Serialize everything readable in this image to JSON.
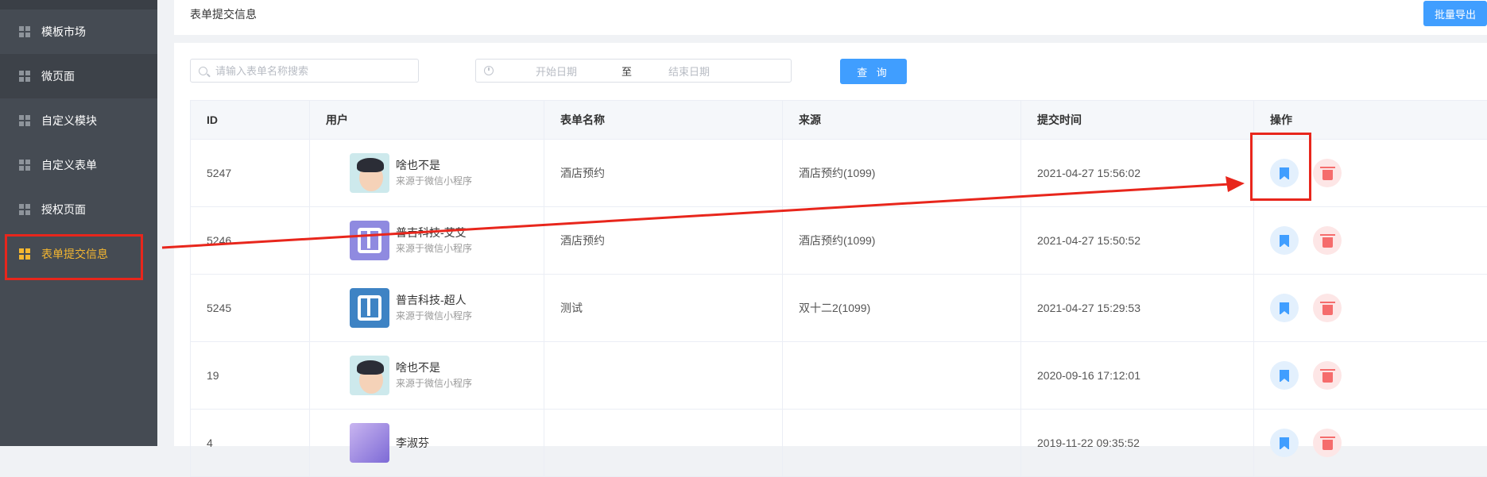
{
  "sidebar": {
    "items": [
      {
        "label": "模板市场",
        "icon": "grid-icon"
      },
      {
        "label": "微页面",
        "icon": "grid-icon"
      },
      {
        "label": "自定义模块",
        "icon": "grid-icon"
      },
      {
        "label": "自定义表单",
        "icon": "grid-icon"
      },
      {
        "label": "授权页面",
        "icon": "grid-icon"
      },
      {
        "label": "表单提交信息",
        "icon": "grid-icon"
      }
    ],
    "active_color": "#f5b730"
  },
  "header": {
    "title": "表单提交信息",
    "export_label": "批量导出"
  },
  "filters": {
    "search_placeholder": "请输入表单名称搜索",
    "date_start_placeholder": "开始日期",
    "date_separator": "至",
    "date_end_placeholder": "结束日期",
    "query_label": "查 询"
  },
  "table": {
    "columns": [
      "ID",
      "用户",
      "表单名称",
      "来源",
      "提交时间",
      "操作"
    ],
    "rows": [
      {
        "id": "5247",
        "user": "啥也不是",
        "user_source": "来源于微信小程序",
        "form": "酒店预约",
        "source": "酒店预约(1099)",
        "time": "2021-04-27 15:56:02"
      },
      {
        "id": "5246",
        "user": "普吉科技-艾艾",
        "user_source": "来源于微信小程序",
        "form": "酒店预约",
        "source": "酒店预约(1099)",
        "time": "2021-04-27 15:50:52"
      },
      {
        "id": "5245",
        "user": "普吉科技-超人",
        "user_source": "来源于微信小程序",
        "form": "测试",
        "source": "双十二2(1099)",
        "time": "2021-04-27 15:29:53"
      },
      {
        "id": "19",
        "user": "啥也不是",
        "user_source": "来源于微信小程序",
        "form": "",
        "source": "",
        "time": "2020-09-16 17:12:01"
      },
      {
        "id": "4",
        "user": "李淑芬",
        "user_source": "",
        "form": "",
        "source": "",
        "time": "2019-11-22 09:35:52"
      }
    ]
  },
  "colors": {
    "primary": "#409eff",
    "danger": "#f56c6c",
    "sidebar_bg": "#454b53",
    "annotation": "#e8261c"
  }
}
